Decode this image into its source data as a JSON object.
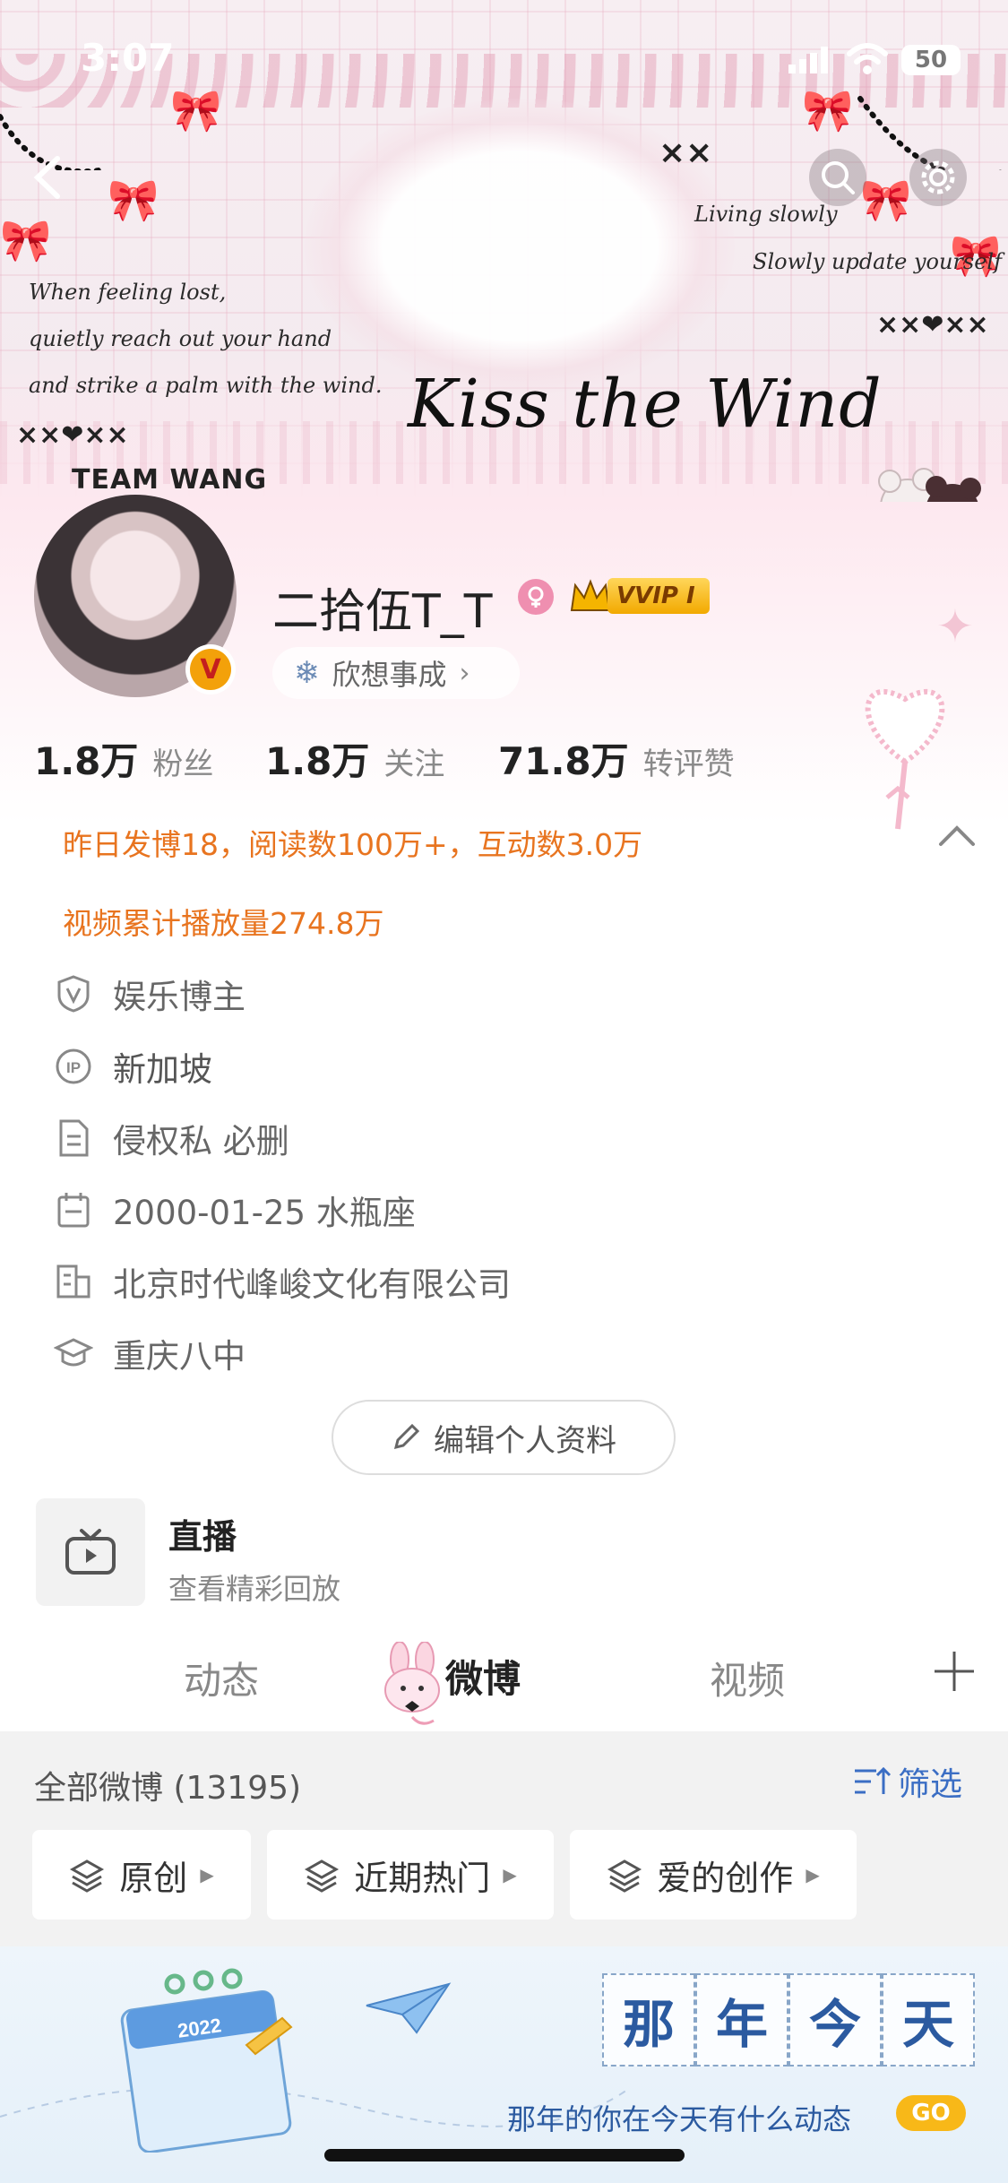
{
  "status_bar": {
    "time": "3:07",
    "battery": "50"
  },
  "banner": {
    "lines_left": [
      "When feeling lost,",
      "quietly reach out your hand",
      "and strike a palm with the wind."
    ],
    "lines_right": [
      "Living slowly",
      "Slowly update yourself"
    ],
    "title": "Kiss the Wind",
    "team": "TEAM WANG",
    "marks_left": "××❤××",
    "marks_right": "××❤××",
    "marks_mid": "××"
  },
  "profile": {
    "username": "二拾伍T_T",
    "vip_label": "VVIP I",
    "motto": "欣想事成",
    "stats": [
      {
        "value": "1.8万",
        "label": "粉丝"
      },
      {
        "value": "1.8万",
        "label": "关注"
      },
      {
        "value": "71.8万",
        "label": "转评赞"
      }
    ],
    "activity_line": "昨日发博18，阅读数100万+，互动数3.0万",
    "video_line": "视频累计播放量274.8万",
    "info": [
      {
        "icon": "verified-icon",
        "text": "娱乐博主"
      },
      {
        "icon": "ip-icon",
        "text": "新加坡"
      },
      {
        "icon": "document-icon",
        "text": "侵权私 必删"
      },
      {
        "icon": "calendar-icon",
        "text": "2000-01-25 水瓶座"
      },
      {
        "icon": "building-icon",
        "text": "北京时代峰峻文化有限公司"
      },
      {
        "icon": "graduation-cap-icon",
        "text": "重庆八中"
      }
    ],
    "edit_button": "编辑个人资料"
  },
  "live": {
    "title": "直播",
    "subtitle": "查看精彩回放"
  },
  "tabs": [
    "动态",
    "微博",
    "视频"
  ],
  "filter": {
    "title": "全部微博 (13195)",
    "filter_label": "筛选",
    "chips": [
      "原创",
      "近期热门",
      "爱的创作"
    ]
  },
  "promo": {
    "grid_chars": [
      "那",
      "年",
      "今",
      "天"
    ],
    "subtitle": "那年的你在今天有什么动态",
    "go": "GO",
    "calendar_year": "2022"
  }
}
